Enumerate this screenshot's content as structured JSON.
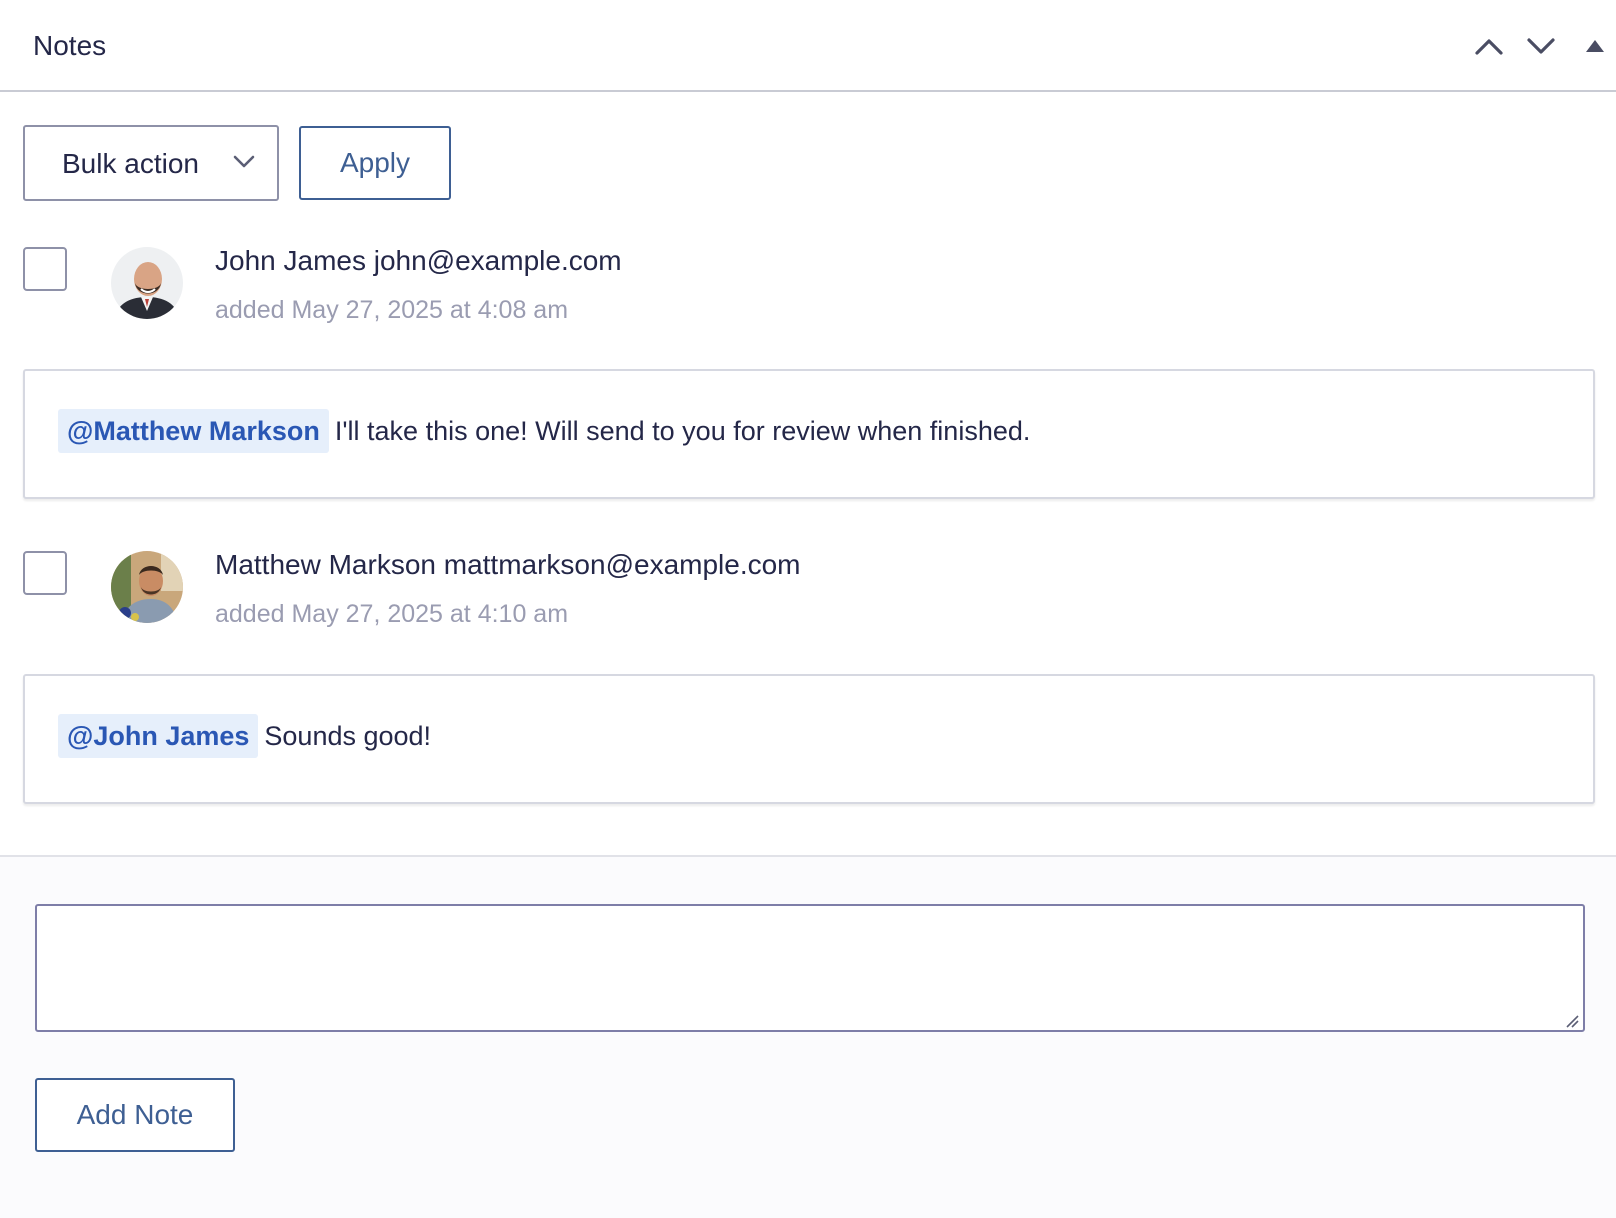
{
  "header": {
    "title": "Notes",
    "icons": [
      "chevron-up-icon",
      "chevron-down-icon",
      "collapse-triangle-icon"
    ]
  },
  "toolbar": {
    "bulk_action_label": "Bulk action",
    "apply_label": "Apply"
  },
  "notes": [
    {
      "author_name": "John James",
      "author_email": "john@example.com",
      "date": "added May 27, 2025 at 4:08 am",
      "mention": "@Matthew Markson",
      "text": "I'll take this one! Will send to you for review when finished."
    },
    {
      "author_name": "Matthew Markson",
      "author_email": "mattmarkson@example.com",
      "date": "added May 27, 2025 at 4:10 am",
      "mention": "@John James",
      "text": "Sounds good!"
    }
  ],
  "composer": {
    "value": "",
    "add_note_label": "Add Note"
  },
  "colors": {
    "accent": "#3e5f93",
    "mention_bg": "#e6effb",
    "mention_text": "#2a57b4",
    "muted_text": "#9a9cb1"
  }
}
